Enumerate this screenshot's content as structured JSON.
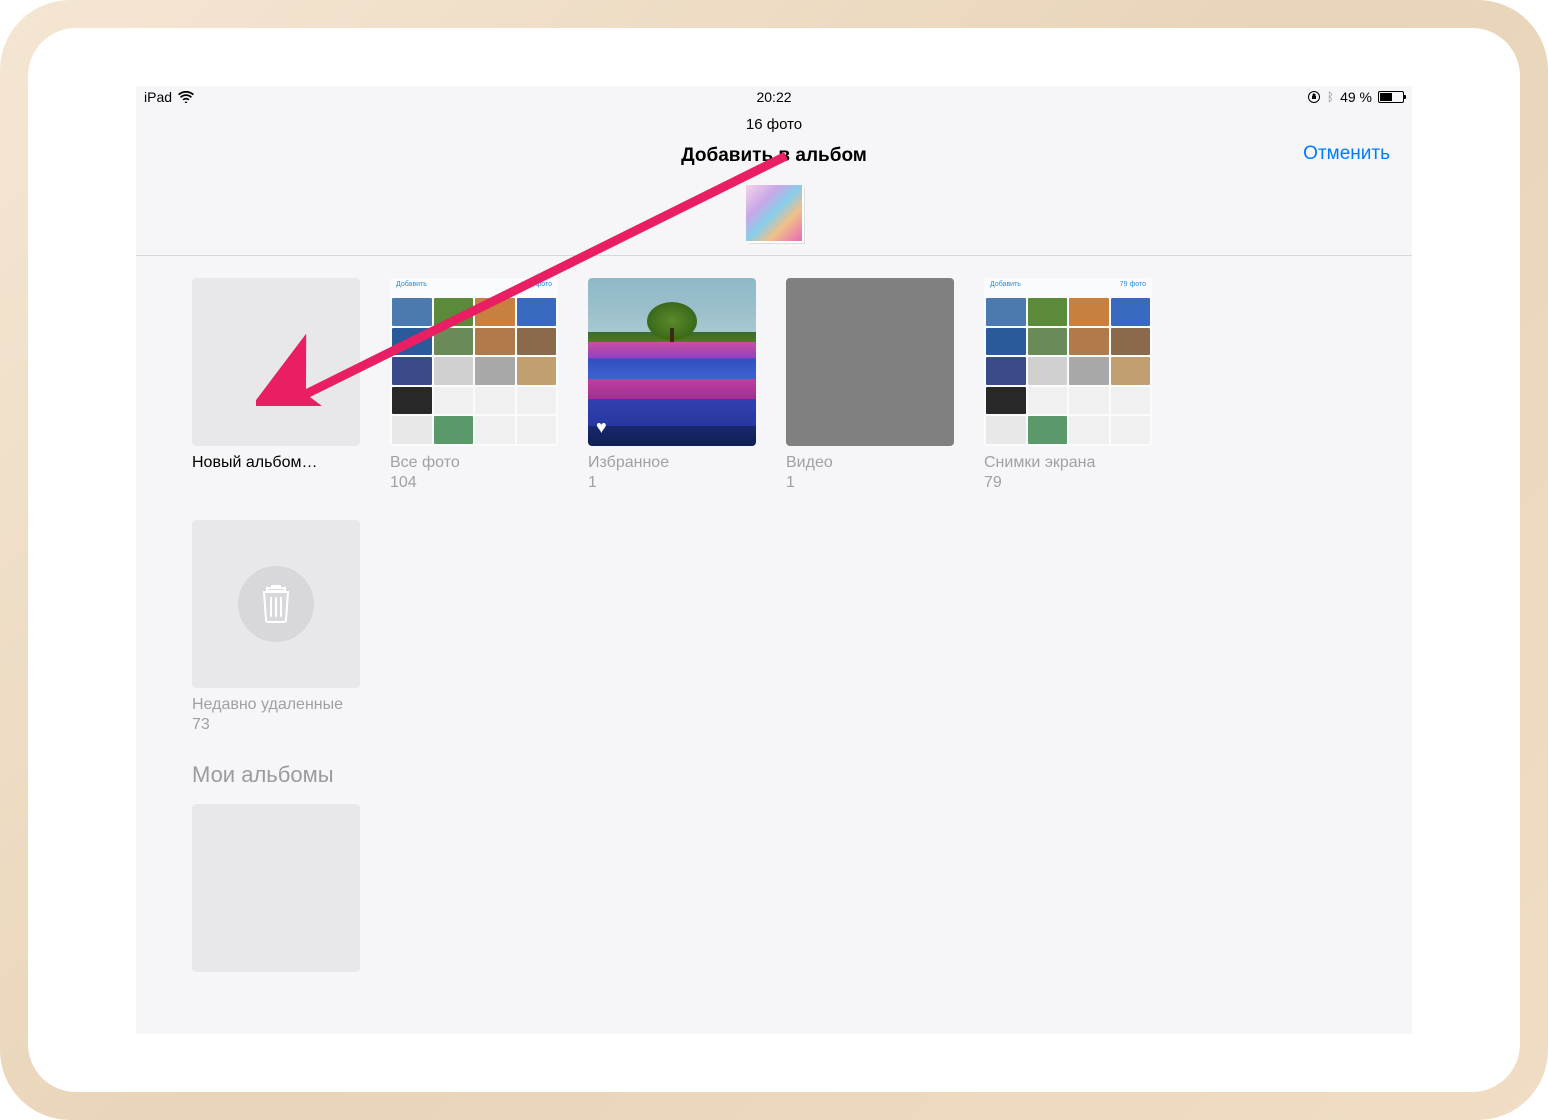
{
  "status_bar": {
    "device": "iPad",
    "time": "20:22",
    "battery_text": "49 %"
  },
  "header": {
    "photo_count": "16 фото",
    "title": "Добавить в альбом",
    "cancel": "Отменить"
  },
  "albums": [
    {
      "label": "Новый альбом…",
      "count": ""
    },
    {
      "label": "Все фото",
      "count": "104"
    },
    {
      "label": "Избранное",
      "count": "1"
    },
    {
      "label": "Видео",
      "count": "1"
    },
    {
      "label": "Снимки экрана",
      "count": "79"
    },
    {
      "label": "Недавно удаленные",
      "count": "73"
    }
  ],
  "sections": {
    "my_albums": "Мои альбомы"
  },
  "collage_header": {
    "left": "Добавить",
    "right": "79 фото"
  }
}
